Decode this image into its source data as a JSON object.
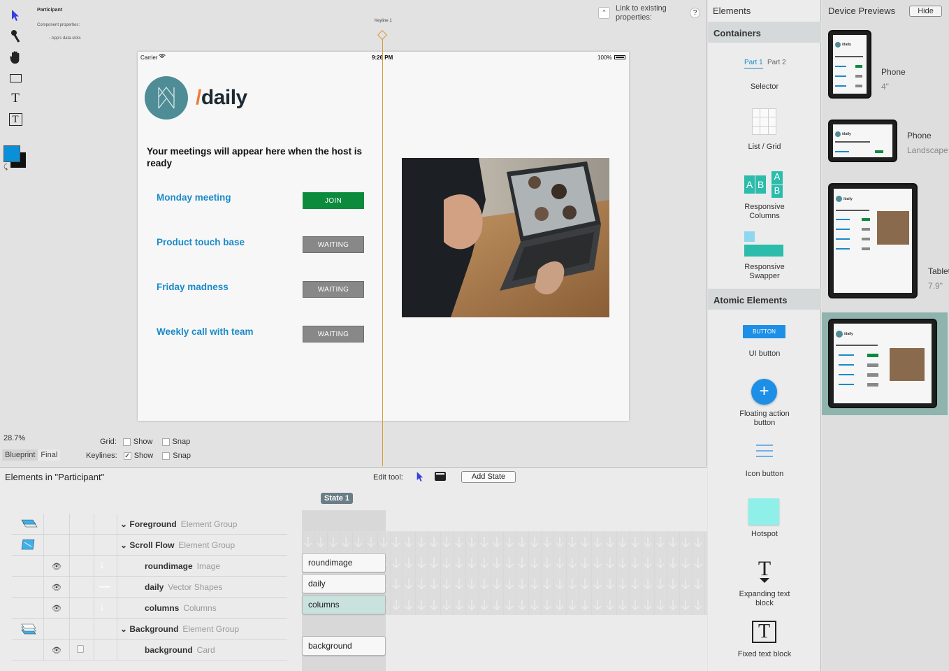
{
  "canvas": {
    "component_title": "Participant",
    "component_props_label": "Component properties:",
    "data_slots_label": "◦ App's data slots",
    "keyline_label": "Keyline 1",
    "link_label_1": "Link to existing",
    "link_label_2": "properties:",
    "help_label": "?",
    "zoom": "28.7%",
    "view_modes": [
      "Blueprint",
      "Final"
    ],
    "grid_label": "Grid:",
    "keylines_label": "Keylines:",
    "show_label": "Show",
    "snap_label": "Snap"
  },
  "device": {
    "carrier": "Carrier",
    "time": "9:26 PM",
    "battery": "100%",
    "logo_text": "/daily",
    "heading": "Your meetings will appear here when the host is ready",
    "meetings": [
      {
        "name": "Monday meeting",
        "button": "JOIN"
      },
      {
        "name": "Product touch base",
        "button": "WAITING"
      },
      {
        "name": "Friday madness",
        "button": "WAITING"
      },
      {
        "name": "Weekly call with team",
        "button": "WAITING"
      }
    ]
  },
  "elements_panel": {
    "title": "Elements",
    "containers_title": "Containers",
    "selector_tabs": [
      "Part 1",
      "Part 2"
    ],
    "containers": [
      "Selector",
      "List / Grid",
      "Responsive Columns",
      "Responsive Swapper"
    ],
    "atomic_title": "Atomic Elements",
    "ui_button_text": "BUTTON",
    "atomic": [
      "UI button",
      "Floating action button",
      "Icon button",
      "Hotspot",
      "Expanding text block",
      "Fixed text block"
    ],
    "ab_letters": [
      "A",
      "B",
      "A",
      "B"
    ]
  },
  "device_previews": {
    "title": "Device Previews",
    "hide_label": "Hide",
    "devices": [
      {
        "name": "Phone",
        "size": "4\""
      },
      {
        "name": "Phone",
        "size": "Landscape"
      },
      {
        "name": "Tablet",
        "size": "7.9\""
      }
    ]
  },
  "bottom": {
    "title": "Elements in \"Participant\"",
    "edit_tool_label": "Edit tool:",
    "add_state_label": "Add State",
    "state_label": "State 1",
    "rows": [
      {
        "name": "Foreground",
        "type": "Element Group"
      },
      {
        "name": "Scroll Flow",
        "type": "Element Group"
      },
      {
        "name": "roundimage",
        "type": "Image"
      },
      {
        "name": "daily",
        "type": "Vector Shapes"
      },
      {
        "name": "columns",
        "type": "Columns"
      },
      {
        "name": "Background",
        "type": "Element Group"
      },
      {
        "name": "background",
        "type": "Card"
      }
    ],
    "chips": [
      "roundimage",
      "daily",
      "columns",
      "background"
    ]
  },
  "colors": {
    "accent_blue": "#1a8ac8",
    "join_green": "#0d8b3d",
    "waiting_gray": "#888888",
    "selected_preview": "#8fb3ad"
  }
}
